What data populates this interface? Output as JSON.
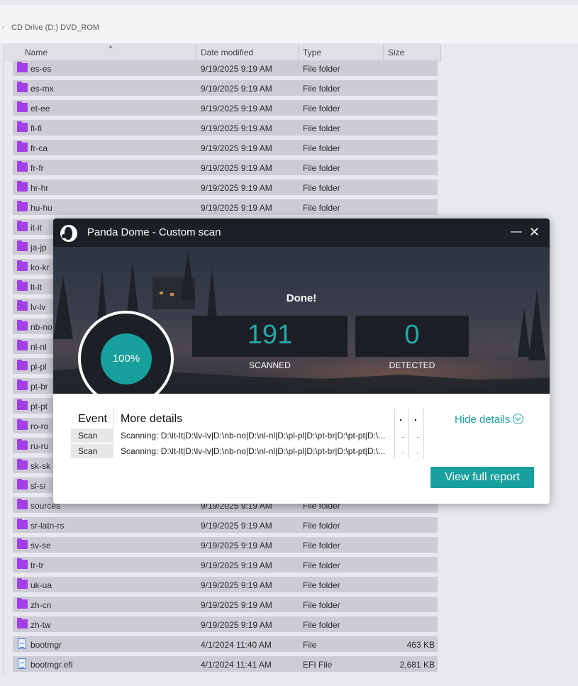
{
  "explorer": {
    "breadcrumb": "CD Drive (D:) DVD_ROM",
    "columns": {
      "name": "Name",
      "date": "Date modified",
      "type": "Type",
      "size": "Size"
    },
    "rows": [
      {
        "name": "es-es",
        "date": "9/19/2025 9:19 AM",
        "type": "File folder",
        "size": "",
        "icon": "folder-icon"
      },
      {
        "name": "es-mx",
        "date": "9/19/2025 9:19 AM",
        "type": "File folder",
        "size": "",
        "icon": "folder-icon"
      },
      {
        "name": "et-ee",
        "date": "9/19/2025 9:19 AM",
        "type": "File folder",
        "size": "",
        "icon": "folder-icon"
      },
      {
        "name": "fi-fi",
        "date": "9/19/2025 9:19 AM",
        "type": "File folder",
        "size": "",
        "icon": "folder-icon"
      },
      {
        "name": "fr-ca",
        "date": "9/19/2025 9:19 AM",
        "type": "File folder",
        "size": "",
        "icon": "folder-icon"
      },
      {
        "name": "fr-fr",
        "date": "9/19/2025 9:19 AM",
        "type": "File folder",
        "size": "",
        "icon": "folder-icon"
      },
      {
        "name": "hr-hr",
        "date": "9/19/2025 9:19 AM",
        "type": "File folder",
        "size": "",
        "icon": "folder-icon"
      },
      {
        "name": "hu-hu",
        "date": "9/19/2025 9:19 AM",
        "type": "File folder",
        "size": "",
        "icon": "folder-icon"
      },
      {
        "name": "it-it",
        "date": "",
        "type": "",
        "size": "",
        "icon": "folder-icon"
      },
      {
        "name": "ja-jp",
        "date": "",
        "type": "",
        "size": "",
        "icon": "folder-icon"
      },
      {
        "name": "ko-kr",
        "date": "",
        "type": "",
        "size": "",
        "icon": "folder-icon"
      },
      {
        "name": "lt-lt",
        "date": "",
        "type": "",
        "size": "",
        "icon": "folder-icon"
      },
      {
        "name": "lv-lv",
        "date": "",
        "type": "",
        "size": "",
        "icon": "folder-icon"
      },
      {
        "name": "nb-no",
        "date": "",
        "type": "",
        "size": "",
        "icon": "folder-icon"
      },
      {
        "name": "nl-nl",
        "date": "",
        "type": "",
        "size": "",
        "icon": "folder-icon"
      },
      {
        "name": "pl-pl",
        "date": "",
        "type": "",
        "size": "",
        "icon": "folder-icon"
      },
      {
        "name": "pt-br",
        "date": "",
        "type": "",
        "size": "",
        "icon": "folder-icon"
      },
      {
        "name": "pt-pt",
        "date": "",
        "type": "",
        "size": "",
        "icon": "folder-icon"
      },
      {
        "name": "ro-ro",
        "date": "",
        "type": "",
        "size": "",
        "icon": "folder-icon"
      },
      {
        "name": "ru-ru",
        "date": "",
        "type": "",
        "size": "",
        "icon": "folder-icon"
      },
      {
        "name": "sk-sk",
        "date": "",
        "type": "",
        "size": "",
        "icon": "folder-icon"
      },
      {
        "name": "sl-si",
        "date": "",
        "type": "",
        "size": "",
        "icon": "folder-icon"
      },
      {
        "name": "sources",
        "date": "9/19/2025 9:19 AM",
        "type": "File folder",
        "size": "",
        "icon": "folder-icon"
      },
      {
        "name": "sr-latn-rs",
        "date": "9/19/2025 9:19 AM",
        "type": "File folder",
        "size": "",
        "icon": "folder-icon"
      },
      {
        "name": "sv-se",
        "date": "9/19/2025 9:19 AM",
        "type": "File folder",
        "size": "",
        "icon": "folder-icon"
      },
      {
        "name": "tr-tr",
        "date": "9/19/2025 9:19 AM",
        "type": "File folder",
        "size": "",
        "icon": "folder-icon"
      },
      {
        "name": "uk-ua",
        "date": "9/19/2025 9:19 AM",
        "type": "File folder",
        "size": "",
        "icon": "folder-icon"
      },
      {
        "name": "zh-cn",
        "date": "9/19/2025 9:19 AM",
        "type": "File folder",
        "size": "",
        "icon": "folder-icon"
      },
      {
        "name": "zh-tw",
        "date": "9/19/2025 9:19 AM",
        "type": "File folder",
        "size": "",
        "icon": "folder-icon"
      },
      {
        "name": "bootmgr",
        "date": "4/1/2024 11:40 AM",
        "type": "File",
        "size": "463 KB",
        "icon": "file-icon"
      },
      {
        "name": "bootmgr.efi",
        "date": "4/1/2024 11:41 AM",
        "type": "EFI File",
        "size": "2,681 KB",
        "icon": "file-icon"
      }
    ]
  },
  "panda": {
    "title": "Panda Dome - Custom scan",
    "minimize_glyph": "—",
    "close_glyph": "✕",
    "status": "Done!",
    "progress": "100%",
    "progress_value": 1.0,
    "scanned_value": "191",
    "scanned_label": "SCANNED",
    "detected_value": "0",
    "detected_label": "DETECTED",
    "details": {
      "header_event": "Event",
      "header_more": "More details",
      "header_col3": ".",
      "header_col4": ".",
      "rows": [
        {
          "event": "Scan",
          "details": "Scanning: D:\\lt-lt|D:\\lv-lv|D:\\nb-no|D:\\nl-nl|D:\\pl-pl|D:\\pt-br|D:\\pt-pt|D:\\...",
          "c3": "..",
          "c4": ".."
        },
        {
          "event": "Scan",
          "details": "Scanning: D:\\lt-lt|D:\\lv-lv|D:\\nb-no|D:\\nl-nl|D:\\pl-pl|D:\\pt-br|D:\\pt-pt|D:\\...",
          "c3": "..",
          "c4": ".."
        }
      ]
    },
    "hide_details": "Hide details",
    "view_report": "View full report",
    "accent": "#17a09e"
  }
}
